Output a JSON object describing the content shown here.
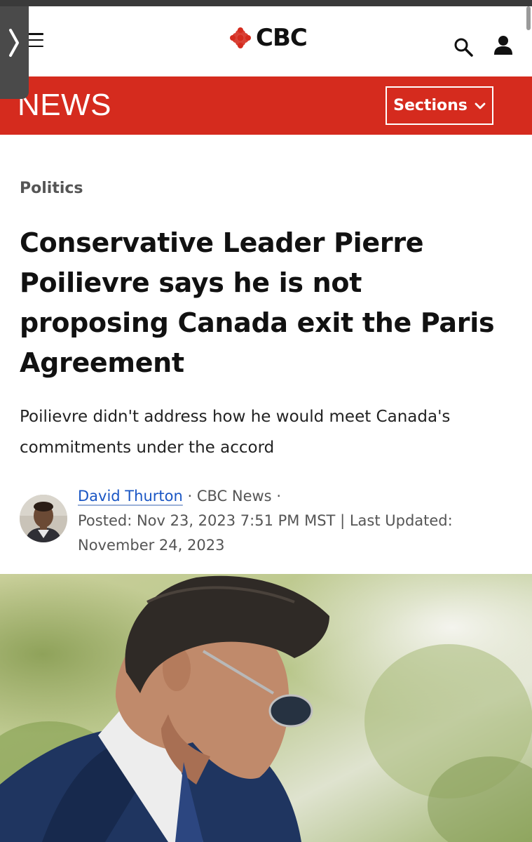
{
  "header": {
    "brand": "CBC",
    "section_title": "NEWS",
    "sections_label": "Sections"
  },
  "article": {
    "category": "Politics",
    "headline": "Conservative Leader Pierre Poilievre says he is not proposing Canada exit the Paris Agreement",
    "deck": "Poilievre didn't address how he would meet Canada's commitments under the accord",
    "author": "David Thurton",
    "outlet": "CBC News",
    "separator": "·",
    "posted_label": "Posted:",
    "posted": "Nov 23, 2023 7:51 PM MST",
    "updated_sep": "|",
    "updated_label": "Last Updated:",
    "updated": "November 24, 2023"
  },
  "colors": {
    "brand_red": "#d52b1e",
    "link_blue": "#1a56c4"
  },
  "icons": [
    "menu-icon",
    "cbc-gem-icon",
    "search-icon",
    "user-icon",
    "chevron-down-icon",
    "side-chevron-icon"
  ]
}
